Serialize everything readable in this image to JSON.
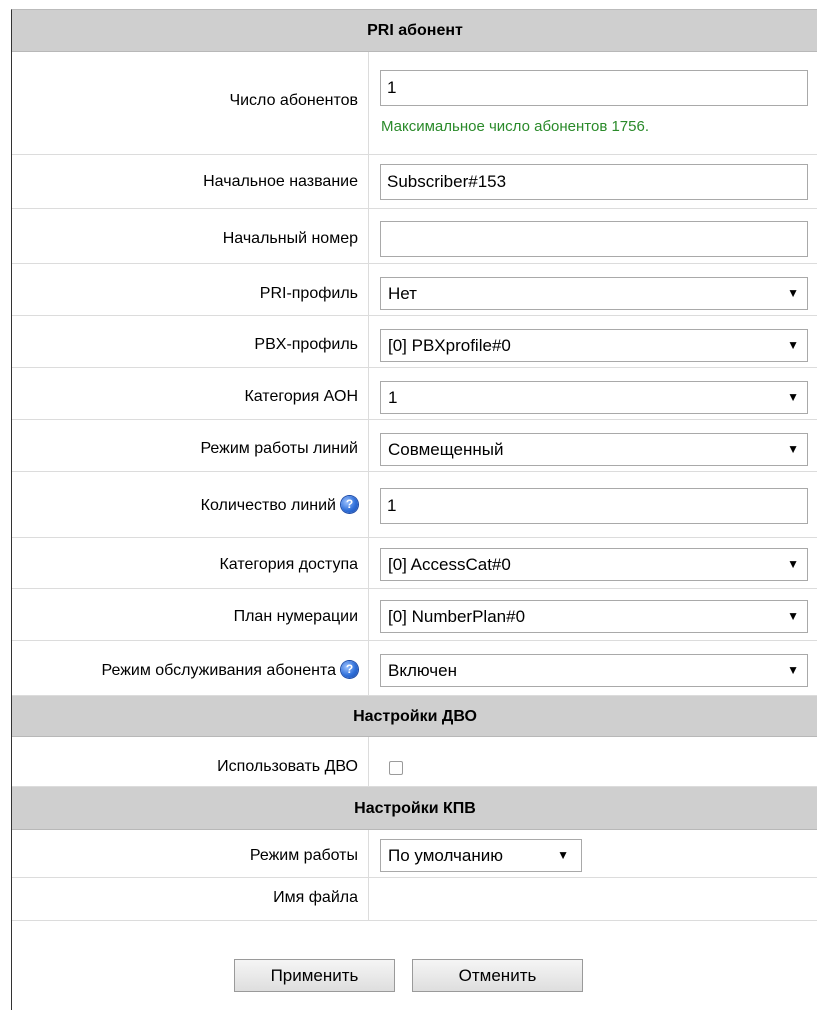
{
  "header": {
    "title": "PRI абонент"
  },
  "fields": {
    "subscriber_count": {
      "label": "Число абонентов",
      "value": "1",
      "hint": "Максимальное число абонентов 1756."
    },
    "initial_name": {
      "label": "Начальное название",
      "value": "Subscriber#153"
    },
    "initial_number": {
      "label": "Начальный номер",
      "value": ""
    },
    "pri_profile": {
      "label": "PRI-профиль",
      "value": "Нет"
    },
    "pbx_profile": {
      "label": "PBX-профиль",
      "value": "[0] PBXprofile#0"
    },
    "aon_category": {
      "label": "Категория АОН",
      "value": "1"
    },
    "line_mode": {
      "label": "Режим работы линий",
      "value": "Совмещенный"
    },
    "line_count": {
      "label": "Количество линий",
      "value": "1"
    },
    "access_category": {
      "label": "Категория доступа",
      "value": "[0] AccessCat#0"
    },
    "numbering_plan": {
      "label": "План нумерации",
      "value": "[0] NumberPlan#0"
    },
    "service_mode": {
      "label": "Режим обслуживания абонента",
      "value": "Включен"
    }
  },
  "dvo": {
    "title": "Настройки ДВО",
    "use_dvo": {
      "label": "Использовать ДВО",
      "checked": false
    }
  },
  "kpv": {
    "title": "Настройки КПВ",
    "mode": {
      "label": "Режим работы",
      "value": "По умолчанию"
    },
    "filename": {
      "label": "Имя файла"
    }
  },
  "actions": {
    "apply": "Применить",
    "cancel": "Отменить"
  },
  "icons": {
    "help": "help-icon",
    "dropdown": "chevron-down-icon"
  }
}
